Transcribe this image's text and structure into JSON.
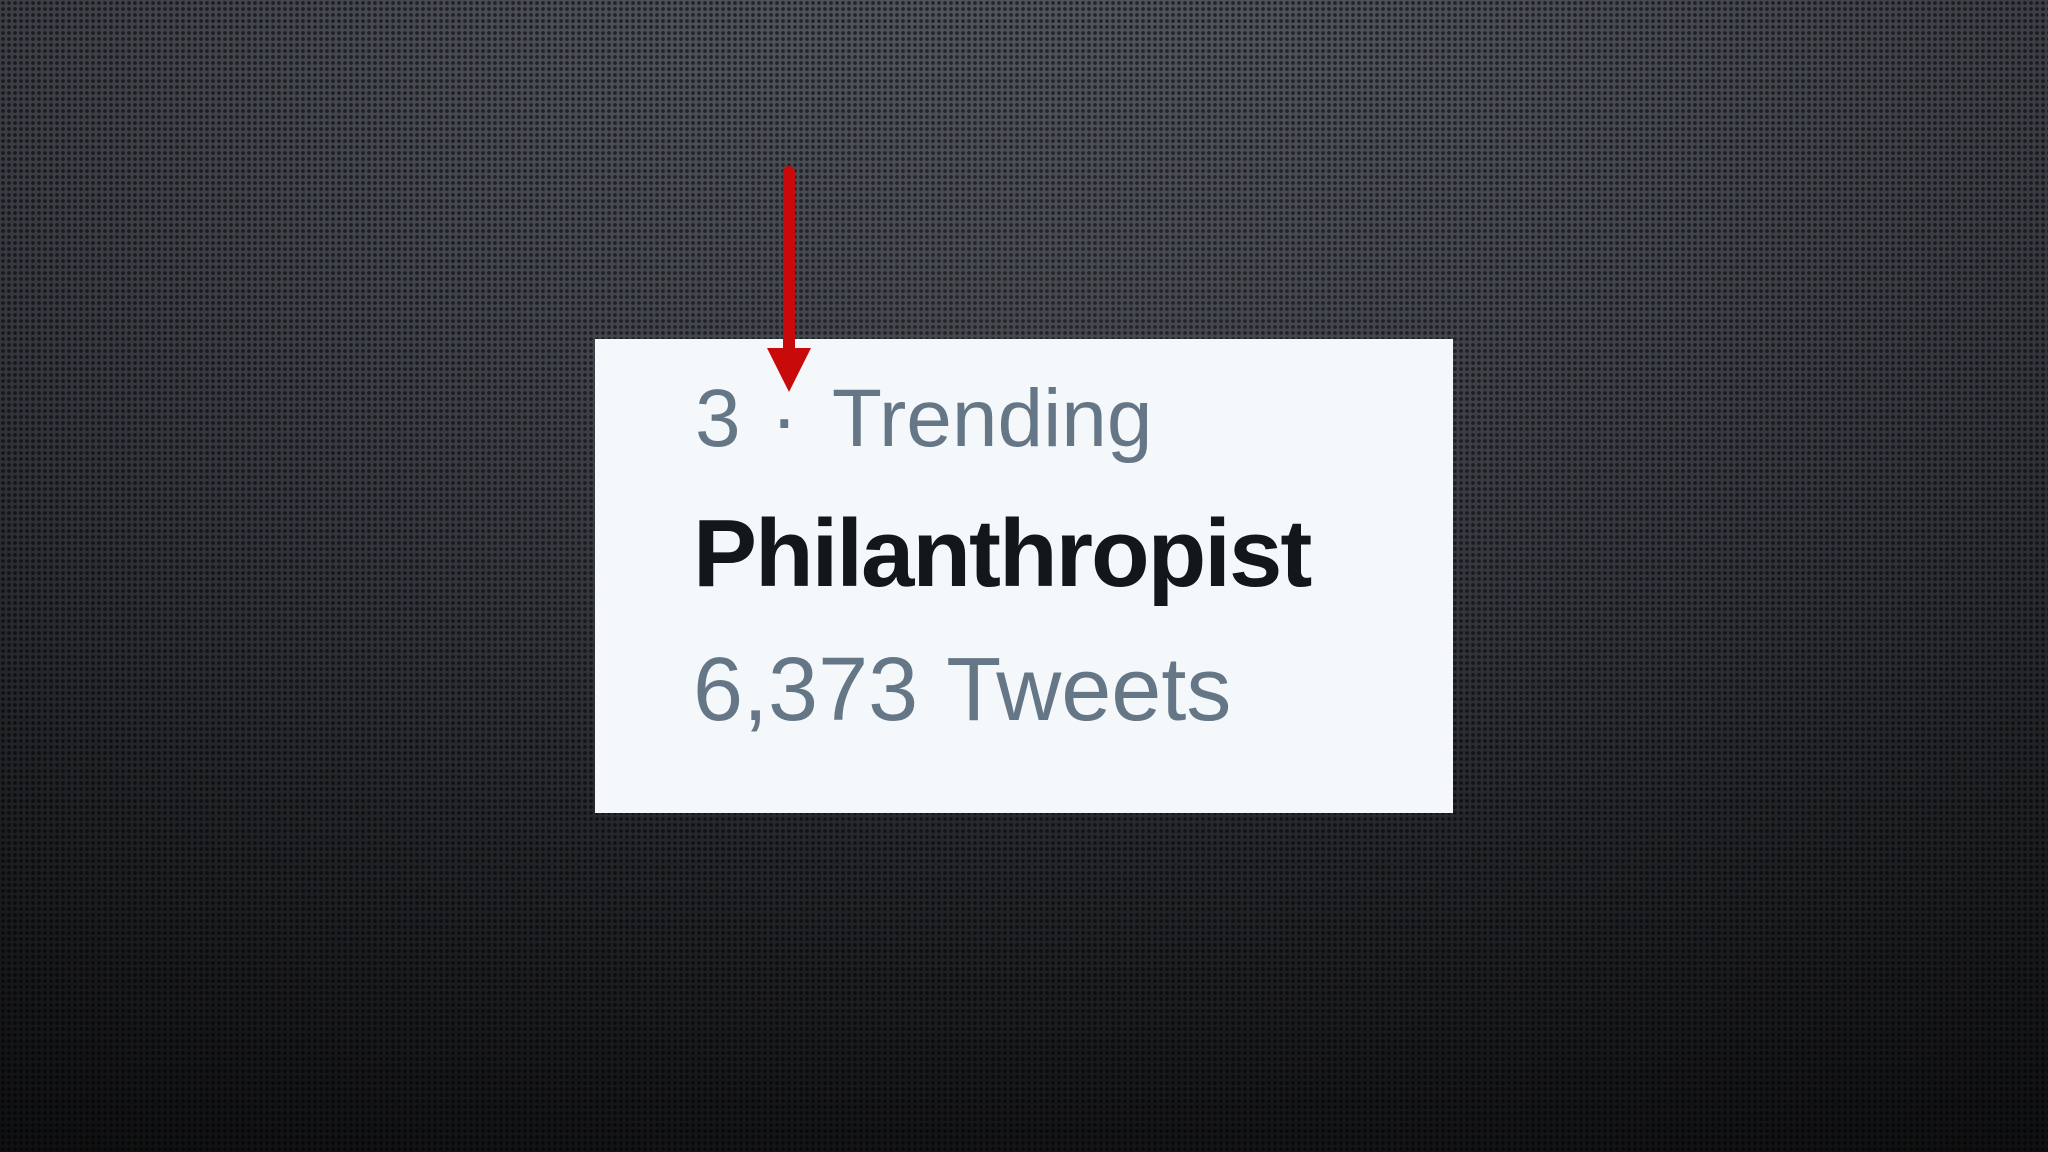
{
  "trend": {
    "rank": "3",
    "separator": "·",
    "category": "Trending",
    "name": "Philanthropist",
    "tweet_count": "6,373",
    "tweet_label": "Tweets"
  },
  "colors": {
    "card_background": "#f5f8fa",
    "secondary_text": "#657786",
    "primary_text": "#14171a",
    "arrow": "#c80a0a"
  },
  "annotation": {
    "icon": "down-arrow-icon"
  }
}
